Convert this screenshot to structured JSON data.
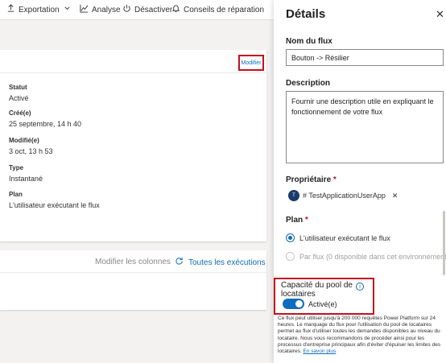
{
  "toolbar": {
    "export": "Exportation",
    "analytics": "Analyse",
    "disable": "Désactiver",
    "repair": "Conseils de réparation"
  },
  "details_card": {
    "edit": "Modifier",
    "fields": [
      {
        "label": "Statut",
        "value": "Activé"
      },
      {
        "label": "Créé(e)",
        "value": "25 septembre, 14 h 40"
      },
      {
        "label": "Modifié(e)",
        "value": "3 oct, 13 h 53"
      },
      {
        "label": "Type",
        "value": "Instantané"
      },
      {
        "label": "Plan",
        "value": "L'utilisateur exécutant le flux"
      }
    ]
  },
  "runs_card": {
    "edit_columns": "Modifier les colonnes",
    "all_runs": "Toutes les exécutions"
  },
  "panel": {
    "title": "Détails",
    "flow_name_label": "Nom du flux",
    "flow_name_value": "Bouton -> Résilier",
    "description_label": "Description",
    "description_value": "Fournir une description utile en expliquant le fonctionnement de votre flux",
    "owner_label": "Propriétaire",
    "owner_initial": "T",
    "owner_name": "# TestApplicationUserApp",
    "plan_label": "Plan",
    "plan_option_user": "L'utilisateur exécutant le flux",
    "plan_option_flow": "Par flux (0 disponible dans cet environnement)",
    "capacity_label": "Capacité du pool de locataires",
    "capacity_toggle_label": "Activé(e)",
    "capacity_enabled": true,
    "note": "Ce flux peut utiliser jusqu'à 200 000 requêtes Power Platform sur 24 heures. Le marquage du flux pour l'utilisation du pool de locataires permet au flux d'utiliser toutes les demandes disponibles au niveau du locataire. Nous vous recommandons de procéder ainsi pour les processus d'entreprise principaux afin d'éviter d'épuiser les limites des locataires.",
    "learn_more": "En savoir plus"
  },
  "colors": {
    "accent": "#0f6cbd",
    "highlight": "#c50f1f"
  }
}
